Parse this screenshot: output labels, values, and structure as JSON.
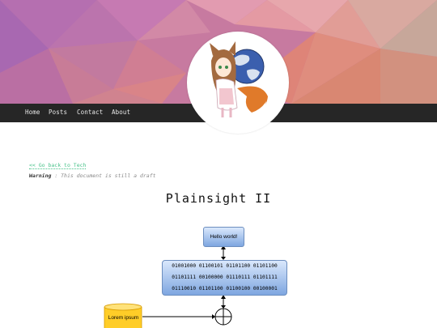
{
  "nav": {
    "items": [
      {
        "label": "Home"
      },
      {
        "label": "Posts"
      },
      {
        "label": "Contact"
      },
      {
        "label": "About"
      }
    ]
  },
  "article": {
    "back_link": "<< Go back to Tech",
    "warning_label": "Warning",
    "warning_text": " : This document is still a draft",
    "title": "Plainsight II"
  },
  "diagram": {
    "hello_label": "Hello world!",
    "binary_lines": [
      "01001000 01100101 01101100 01101100",
      "01101111 00100000 01110111 01101111",
      "01110010 01101100 01100100 00100001"
    ],
    "cylinder_label": "Lorem ipsum"
  },
  "colors": {
    "navbar": "#262626",
    "link": "#49c28a",
    "box_fill_top": "#dae8fc",
    "box_fill_bottom": "#7ea6e0",
    "cylinder_fill": "#ffcd28"
  },
  "icons": {
    "avatar": "firefox-fox-girl-avatar"
  }
}
